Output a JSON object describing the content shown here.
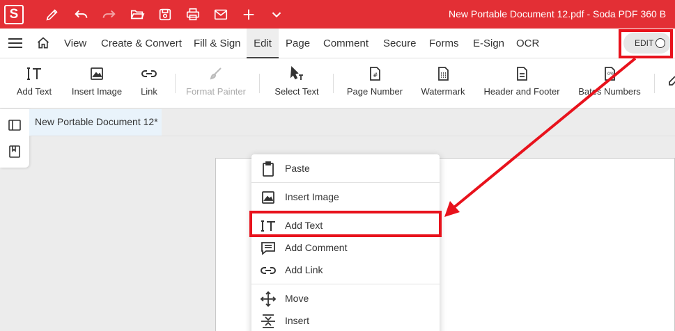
{
  "app": {
    "logo_letter": "S",
    "title": "New Portable Document 12.pdf  -  Soda PDF 360 B",
    "brand_color": "#e32f35"
  },
  "quick_access": [
    {
      "icon": "pen-icon"
    },
    {
      "icon": "undo-icon"
    },
    {
      "icon": "redo-icon"
    },
    {
      "icon": "open-folder-icon"
    },
    {
      "icon": "save-icon"
    },
    {
      "icon": "print-icon"
    },
    {
      "icon": "mail-icon"
    },
    {
      "icon": "plus-icon"
    },
    {
      "icon": "chevron-down-icon"
    }
  ],
  "menu": {
    "items": [
      "View",
      "Create & Convert",
      "Fill & Sign",
      "Edit",
      "Page",
      "Comment",
      "Secure",
      "Forms",
      "E-Sign",
      "OCR"
    ],
    "active": "Edit",
    "edit_toggle_label": "EDIT"
  },
  "toolbar": {
    "tools": [
      {
        "label": "Add Text",
        "icon": "add-text-icon"
      },
      {
        "label": "Insert Image",
        "icon": "image-icon"
      },
      {
        "label": "Link",
        "icon": "link-icon"
      },
      {
        "label": "Format Painter",
        "icon": "brush-icon",
        "disabled": true
      },
      {
        "label": "Select Text",
        "icon": "select-text-icon"
      },
      {
        "label": "Page Number",
        "icon": "page-number-icon"
      },
      {
        "label": "Watermark",
        "icon": "watermark-icon"
      },
      {
        "label": "Header and Footer",
        "icon": "header-footer-icon"
      },
      {
        "label": "Bates Numbers",
        "icon": "bates-icon"
      }
    ]
  },
  "document_tab": {
    "label": "New Portable Document 12*"
  },
  "context_menu": {
    "items": [
      {
        "label": "Paste",
        "icon": "clipboard-icon"
      },
      {
        "label": "Insert Image",
        "icon": "image-icon"
      },
      {
        "label": "Add Text",
        "icon": "add-text-icon",
        "highlighted": true
      },
      {
        "label": "Add Comment",
        "icon": "comment-icon"
      },
      {
        "label": "Add Link",
        "icon": "link-icon"
      },
      {
        "label": "Move",
        "icon": "move-icon"
      },
      {
        "label": "Insert",
        "icon": "insert-icon"
      }
    ]
  },
  "annotation": {
    "color": "#e8121c"
  }
}
